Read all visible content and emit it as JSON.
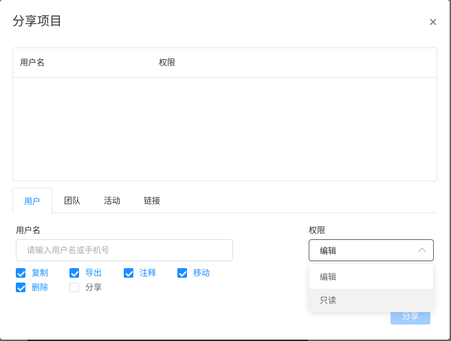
{
  "dialog": {
    "title": "分享项目",
    "close_glyph": "×",
    "close_icon": "close-icon"
  },
  "table": {
    "columns": [
      "用户名",
      "权限"
    ],
    "rows": []
  },
  "tabs": [
    {
      "label": "用户",
      "active": true
    },
    {
      "label": "团队",
      "active": false
    },
    {
      "label": "活动",
      "active": false
    },
    {
      "label": "链接",
      "active": false
    }
  ],
  "form": {
    "username_label": "用户名",
    "username_placeholder": "请输入用户名或手机号",
    "username_value": "",
    "permission_label": "权限",
    "permission_value": "编辑",
    "permission_open": true,
    "permission_options": [
      "编辑",
      "只读"
    ]
  },
  "checkboxes": [
    {
      "label": "复制",
      "checked": true
    },
    {
      "label": "导出",
      "checked": true
    },
    {
      "label": "注释",
      "checked": true
    },
    {
      "label": "移动",
      "checked": true
    },
    {
      "label": "删除",
      "checked": true
    },
    {
      "label": "分享",
      "checked": false
    }
  ],
  "submit_label": "分享",
  "colors": {
    "accent": "#1890ff",
    "disabled_button": "#a0cfff",
    "border": "#e4e7ed"
  }
}
